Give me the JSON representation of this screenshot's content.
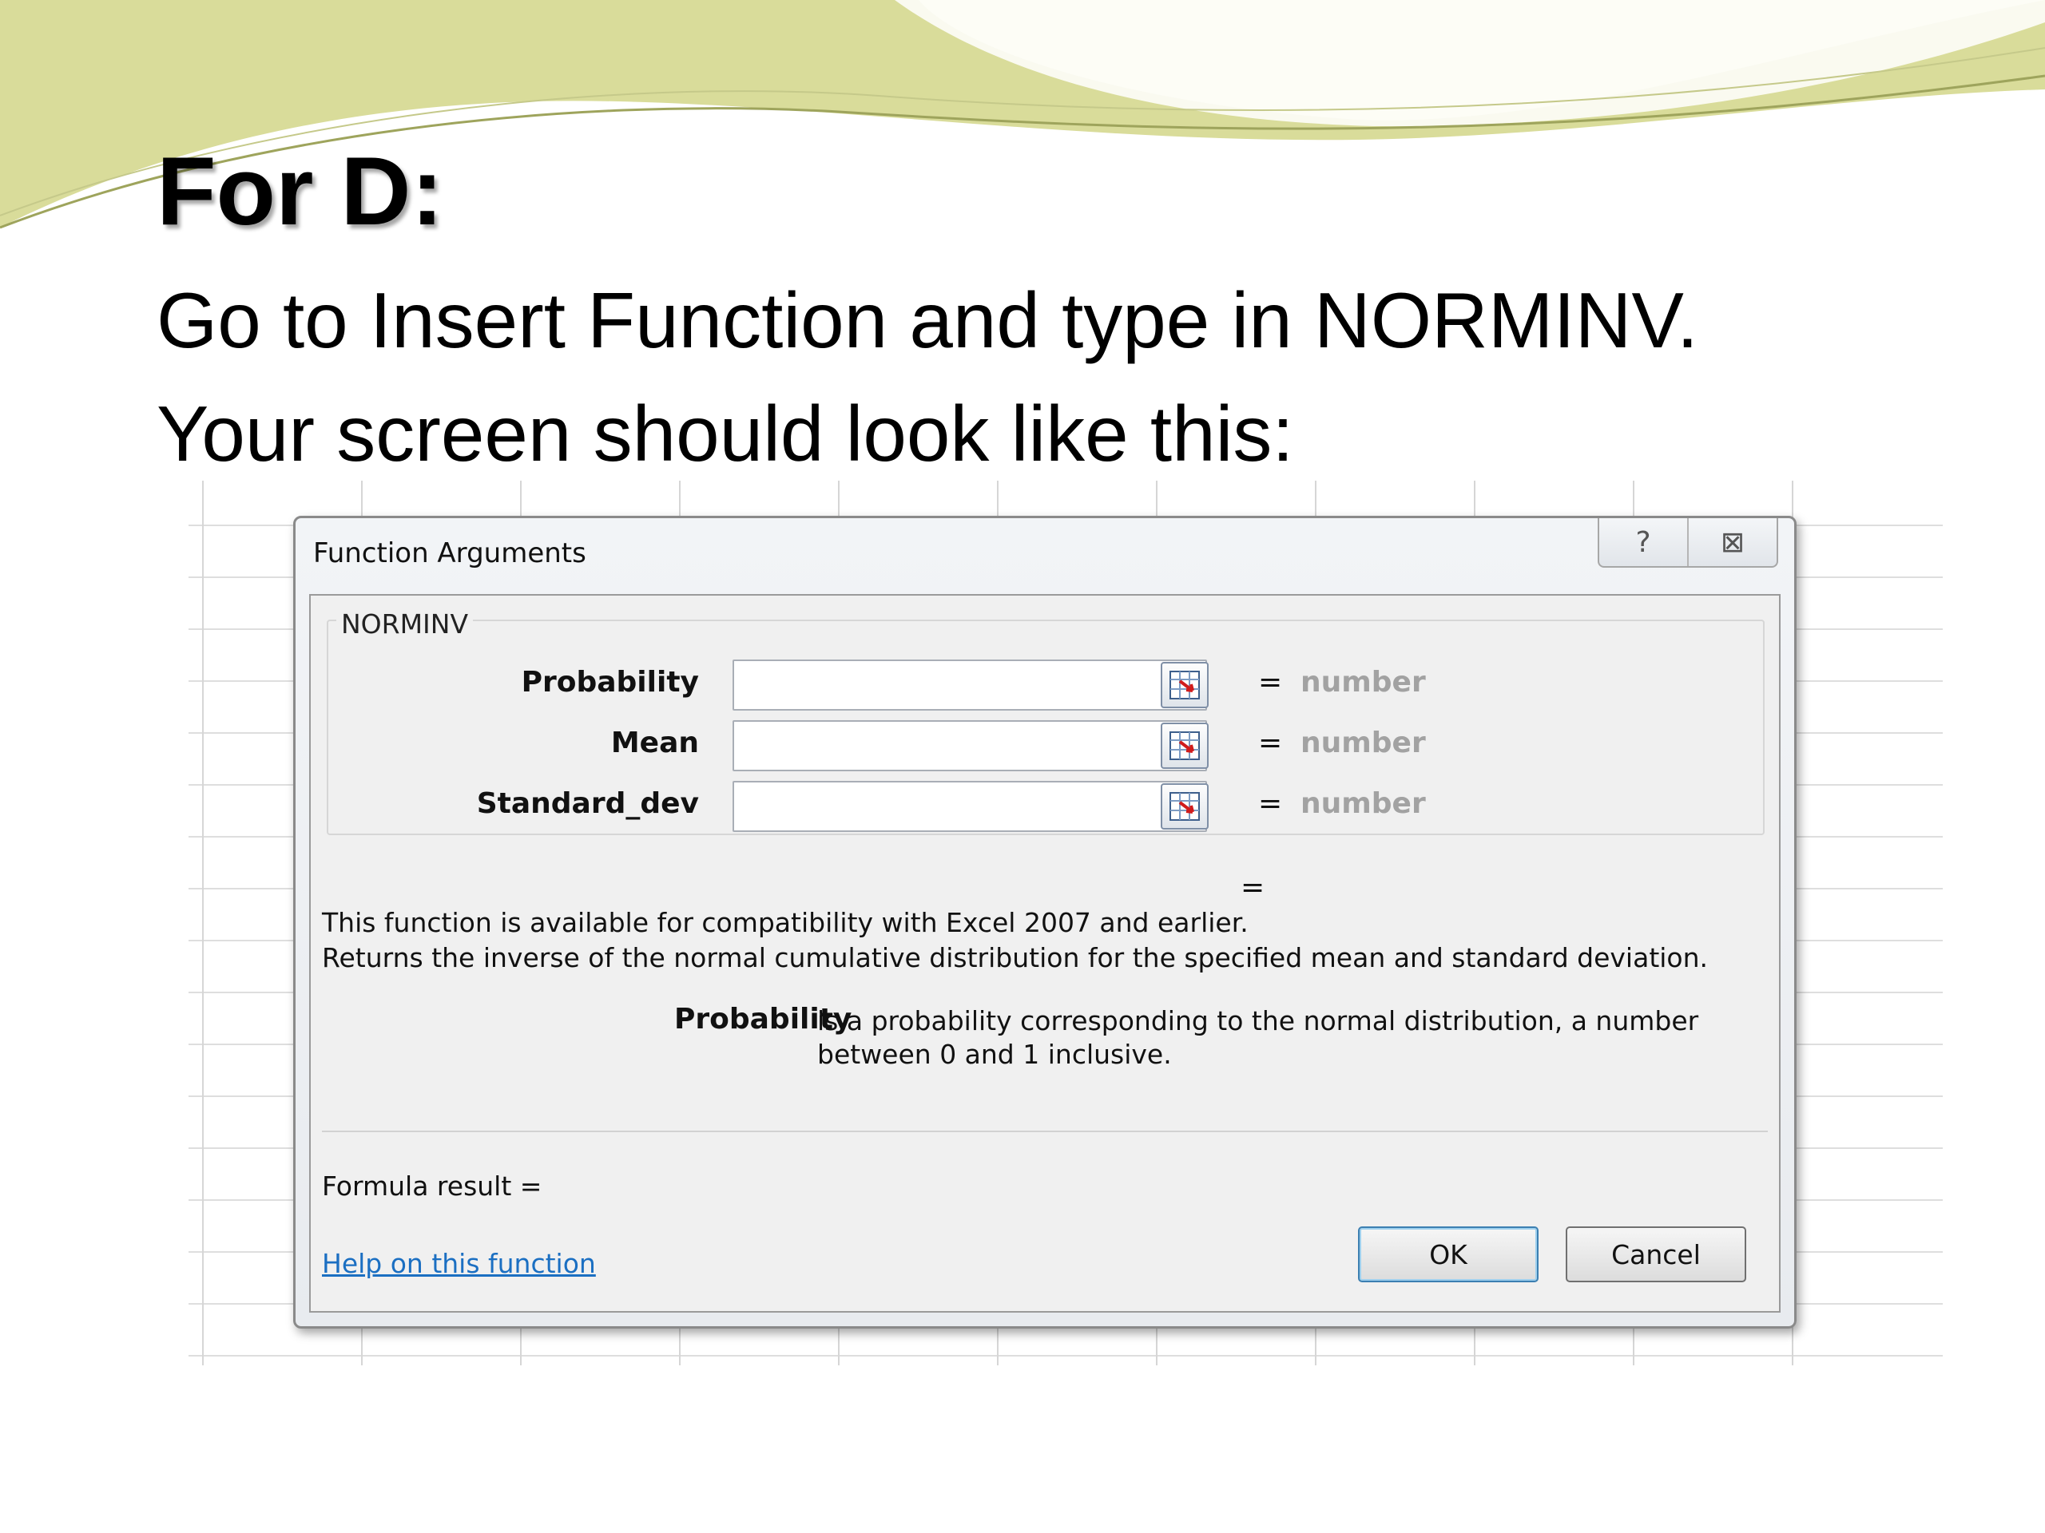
{
  "slide": {
    "title": "For D:",
    "line1": "Go to Insert Function and type in NORMINV.",
    "line2": "Your screen should look like this:"
  },
  "dialog": {
    "title": "Function Arguments",
    "help_glyph": "?",
    "close_glyph": "⊠",
    "function_name": "NORMINV",
    "arguments": [
      {
        "label": "Probability",
        "value": "",
        "equals": "=",
        "hint": "number"
      },
      {
        "label": "Mean",
        "value": "",
        "equals": "=",
        "hint": "number"
      },
      {
        "label": "Standard_dev",
        "value": "",
        "equals": "=",
        "hint": "number"
      }
    ],
    "result_equals": "=",
    "compat_note": "This function is available for compatibility with Excel 2007 and earlier.",
    "description": "Returns the inverse of the normal cumulative distribution for the specified mean and standard deviation.",
    "arg_help": {
      "name": "Probability",
      "text": "is a probability corresponding to the normal distribution, a number between 0 and 1 inclusive."
    },
    "formula_result_label": "Formula result =",
    "help_link": "Help on this function",
    "ok_label": "OK",
    "cancel_label": "Cancel"
  },
  "icons": [
    "help-icon",
    "close-icon",
    "range-select-icon"
  ]
}
